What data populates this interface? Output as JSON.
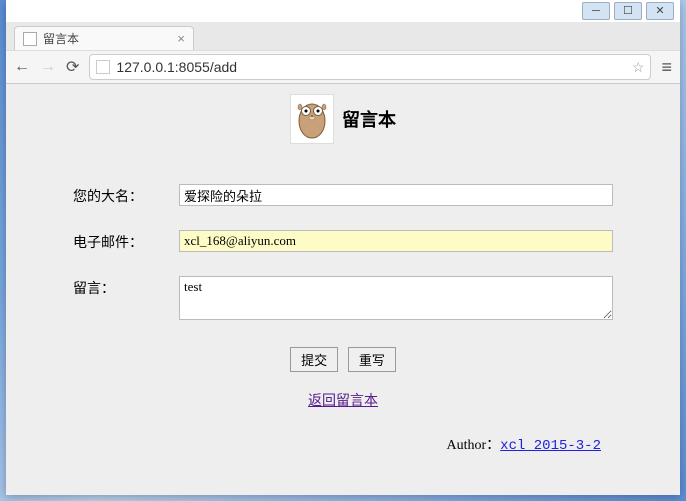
{
  "window": {
    "tab_title": "留言本",
    "url": "127.0.0.1:8055/add"
  },
  "page": {
    "heading": "留言本",
    "labels": {
      "name": "您的大名：",
      "email": "电子邮件：",
      "message": "留言："
    },
    "values": {
      "name": "爱探险的朵拉",
      "email": "xcl_168@aliyun.com",
      "message": "test"
    },
    "buttons": {
      "submit": "提交",
      "reset": "重写"
    },
    "back_link": "返回留言本",
    "author_prefix": "Author：",
    "author_link": "xcl 2015-3-2"
  }
}
